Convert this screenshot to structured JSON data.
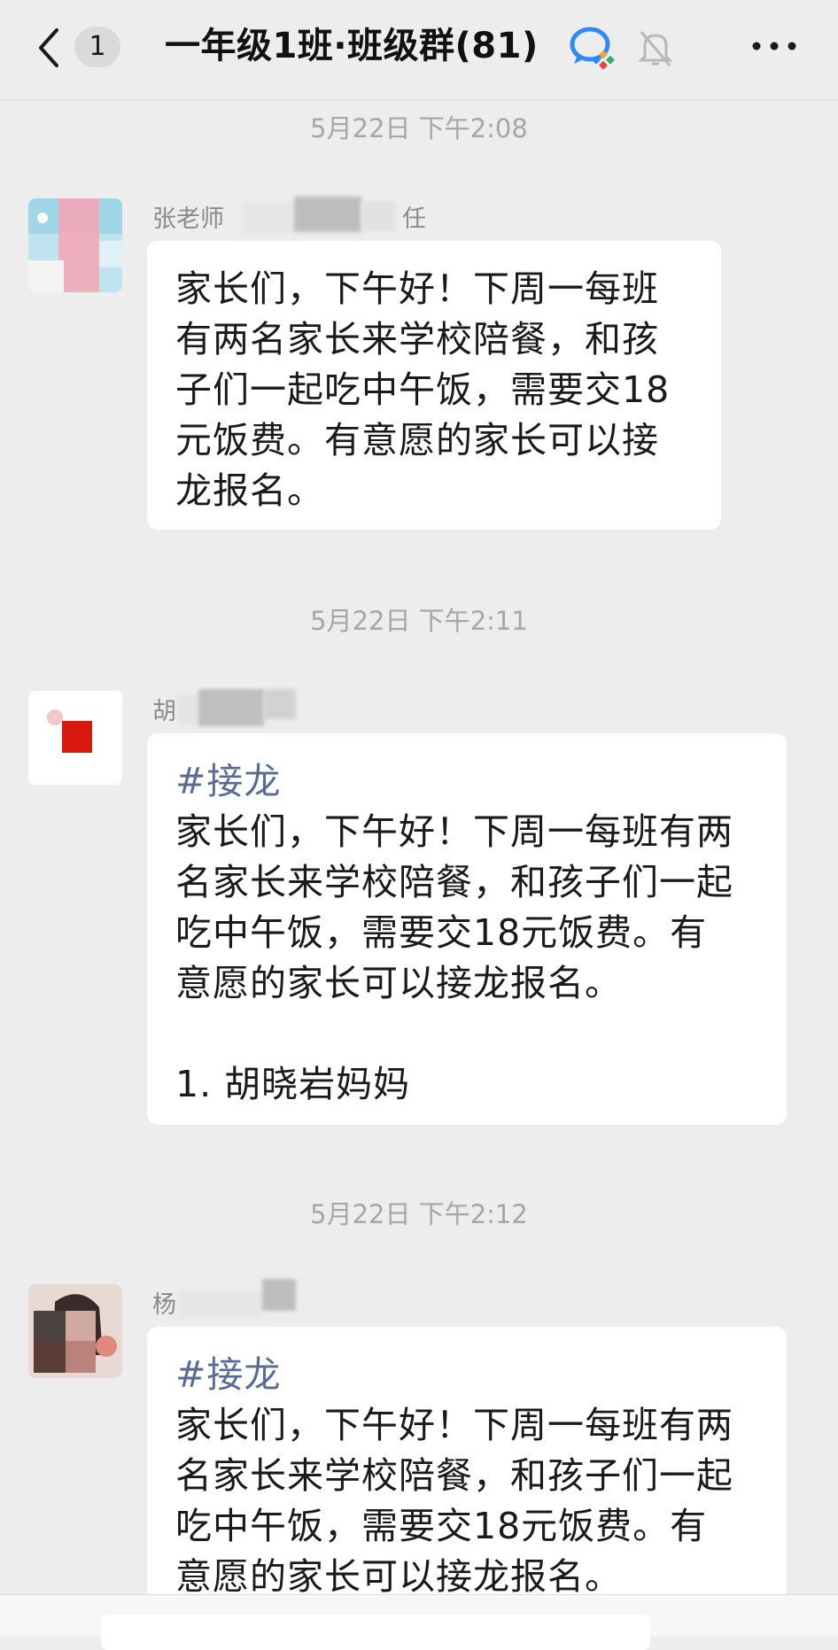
{
  "header": {
    "unread_count": "1",
    "title": "一年级1班·班级群(81)"
  },
  "colors": {
    "background": "#ededed",
    "bubble": "#ffffff",
    "link": "#576b95",
    "timestamp": "#a6a6a6"
  },
  "messages": [
    {
      "timestamp": "5月22日 下午2:08",
      "sender_prefix": "张老师",
      "sender_suffix": "任",
      "lines": [
        "家长们，下午好！下周一每班",
        "有两名家长来学校陪餐，和孩",
        "子们一起吃中午饭，需要交18",
        "元饭费。有意愿的家长可以接",
        "龙报名。"
      ]
    },
    {
      "timestamp": "5月22日 下午2:11",
      "sender_prefix": "胡",
      "hashtag": "#接龙",
      "lines": [
        "家长们，下午好！下周一每班有两",
        "名家长来学校陪餐，和孩子们一起",
        "吃中午饭，需要交18元饭费。有",
        "意愿的家长可以接龙报名。"
      ],
      "entry": "1. 胡晓岩妈妈"
    },
    {
      "timestamp": "5月22日 下午2:12",
      "sender_prefix": "杨",
      "hashtag": "#接龙",
      "lines": [
        "家长们，下午好！下周一每班有两",
        "名家长来学校陪餐，和孩子们一起",
        "吃中午饭，需要交18元饭费。有",
        "意愿的家长可以接龙报名。"
      ]
    }
  ],
  "icons": {
    "back": "chevron-left-icon",
    "wecom": "wecom-logo-icon",
    "mute": "bell-muted-icon",
    "more": "more-dots-icon"
  }
}
